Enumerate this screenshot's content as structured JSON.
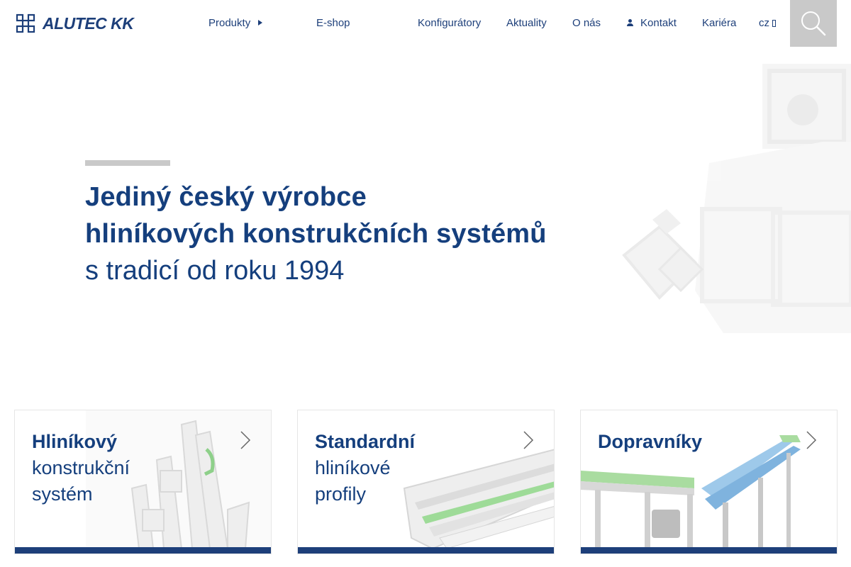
{
  "brand": {
    "name": "ALUTEC KK",
    "color": "#1d3f7a"
  },
  "nav": {
    "produkty": "Produkty",
    "eshop": "E-shop",
    "konfiguratory": "Konfigurátory",
    "aktuality": "Aktuality",
    "onas": "O nás",
    "kontakt": "Kontakt",
    "kariera": "Kariéra",
    "lang": "cz"
  },
  "icons": {
    "logo": "alutec-grid-logo-icon",
    "caret": "caret-right-icon",
    "user": "user-icon",
    "search": "search-icon",
    "arrow": "chevron-right-icon"
  },
  "hero": {
    "line1": "Jediný český výrobce",
    "line2": "hliníkových konstrukčních systémů",
    "line3": "s tradicí od roku 1994"
  },
  "cards": [
    {
      "title_bold": "Hliníkový",
      "title_rest_1": "konstrukční",
      "title_rest_2": "systém"
    },
    {
      "title_bold": "Standardní",
      "title_rest_1": "hliníkové",
      "title_rest_2": "profily"
    },
    {
      "title_bold": "Dopravníky",
      "title_rest_1": "",
      "title_rest_2": ""
    }
  ],
  "colors": {
    "accent": "#1d3f7a",
    "search_bg": "#c9c9c9",
    "hero_bar": "#c9c9c9"
  }
}
